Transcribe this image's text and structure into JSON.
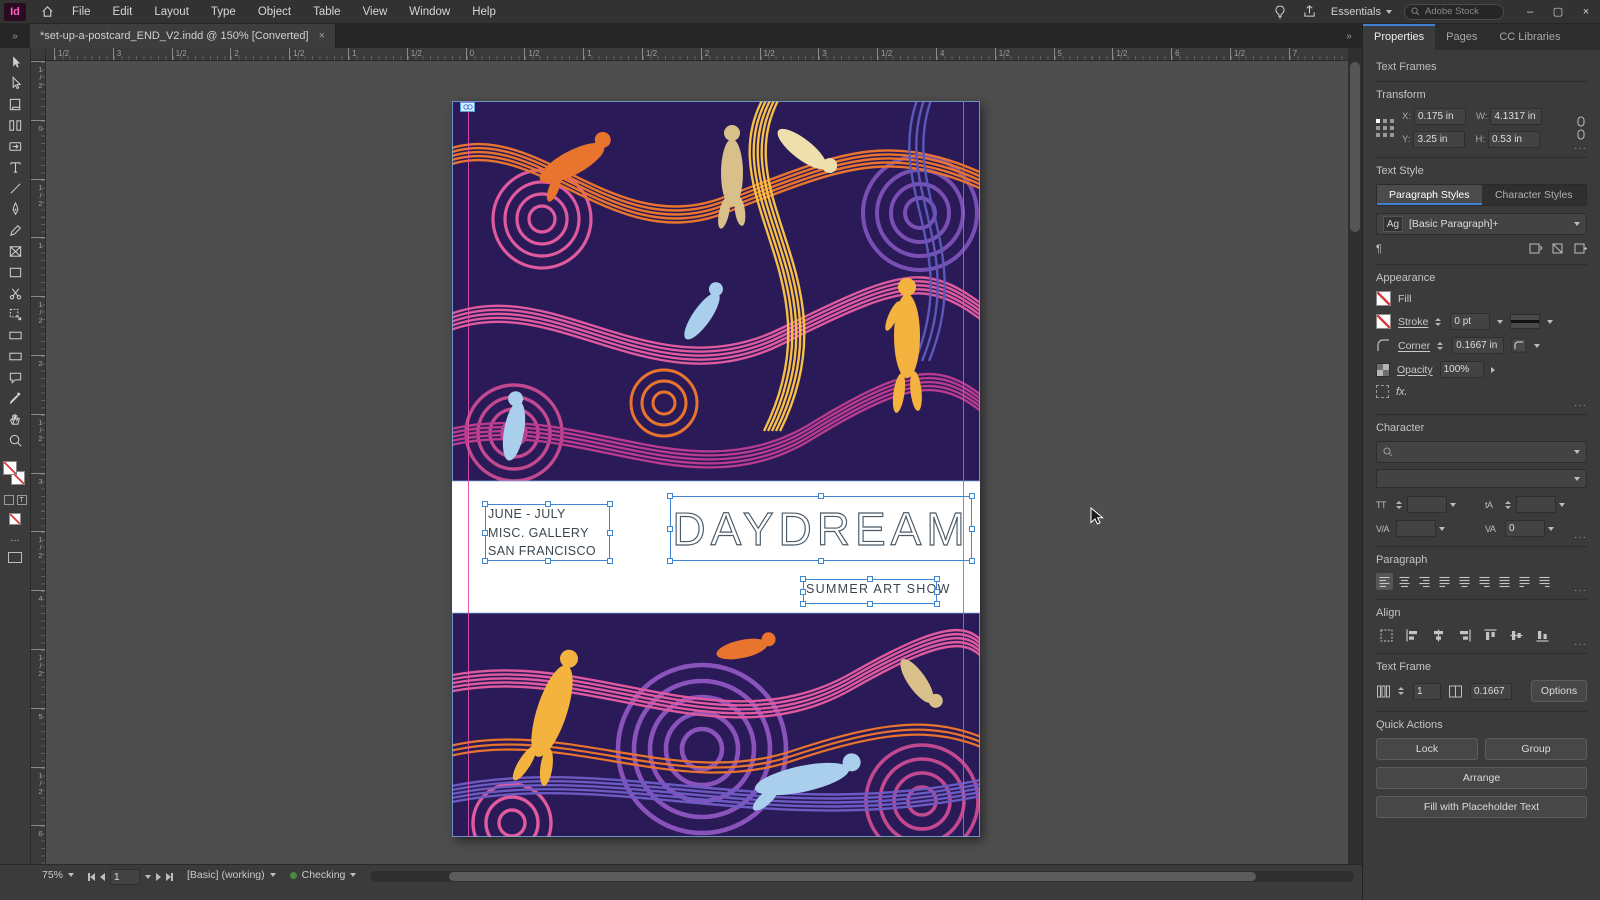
{
  "app": {
    "logo": "Id",
    "menus": [
      "File",
      "Edit",
      "Layout",
      "Type",
      "Object",
      "Table",
      "View",
      "Window",
      "Help"
    ],
    "workspace": "Essentials",
    "search_placeholder": "Adobe Stock"
  },
  "icons": {
    "collapse": "»",
    "more": "···",
    "ellipsis": "…",
    "close": "×",
    "minimize": "–",
    "maximize": "▢",
    "pilcrow": "¶",
    "link": "∞"
  },
  "doc_tab": {
    "title": "*set-up-a-postcard_END_V2.indd @ 150% [Converted]"
  },
  "rulers": {
    "h": [
      "1/2",
      "3",
      "1/2",
      "2",
      "1/2",
      "1",
      "1/2",
      "0",
      "1/2",
      "1",
      "1/2",
      "2",
      "1/2",
      "3",
      "1/2",
      "4",
      "1/2",
      "5",
      "1/2",
      "6",
      "1/2",
      "7"
    ],
    "v": [
      "1/2",
      "0",
      "1/2",
      "1",
      "1/2",
      "2",
      "1/2",
      "3",
      "1/2",
      "4",
      "1/2",
      "5",
      "1/2",
      "6"
    ]
  },
  "artboard": {
    "info_lines": [
      "JUNE - JULY",
      "MISC. GALLERY",
      "SAN FRANCISCO"
    ],
    "title": "DAYDREAM",
    "subtitle": "SUMMER ART SHOW"
  },
  "panel": {
    "tabs": [
      "Properties",
      "Pages",
      "CC Libraries"
    ],
    "selection_type": "Text Frames",
    "transform": {
      "label": "Transform",
      "x_label": "X:",
      "x_value": "0.175 in",
      "y_label": "Y:",
      "y_value": "3.25 in",
      "w_label": "W:",
      "w_value": "4.1317 in",
      "h_label": "H:",
      "h_value": "0.53 in"
    },
    "text_style": {
      "label": "Text Style",
      "paragraph_tab": "Paragraph Styles",
      "character_tab": "Character Styles",
      "style_icon": "Ag",
      "style_name": "[Basic Paragraph]+"
    },
    "appearance": {
      "label": "Appearance",
      "fill_label": "Fill",
      "stroke_label": "Stroke",
      "stroke_value": "0 pt",
      "corner_label": "Corner",
      "corner_value": "0.1667 in",
      "opacity_label": "Opacity",
      "opacity_value": "100%",
      "fx_label": "fx."
    },
    "character": {
      "label": "Character",
      "tracking_value": "0",
      "glyphs": {
        "size": "TT",
        "leading": "tA",
        "kerning": "V/A",
        "tracking": "VA"
      }
    },
    "paragraph": {
      "label": "Paragraph"
    },
    "align": {
      "label": "Align"
    },
    "text_frame": {
      "label": "Text Frame",
      "columns_value": "1",
      "inset_value": "0.1667",
      "options_label": "Options"
    },
    "quick_actions": {
      "label": "Quick Actions",
      "lock": "Lock",
      "group": "Group",
      "arrange": "Arrange",
      "fill_placeholder": "Fill with Placeholder Text"
    }
  },
  "statusbar": {
    "zoom": "75%",
    "page": "1",
    "preflight_profile": "[Basic] (working)",
    "preflight_status": "Checking"
  },
  "colors": {
    "accent_blue": "#3f7fd6",
    "selection_blue": "#3f86d6",
    "guide_magenta": "#e04fa5",
    "art_background": "#2a1a58"
  }
}
